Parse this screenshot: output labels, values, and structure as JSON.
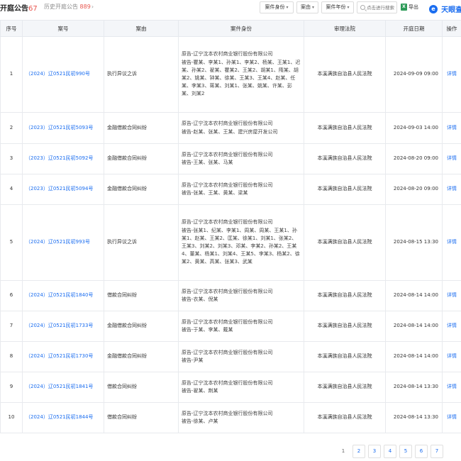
{
  "header": {
    "title": "开庭公告",
    "title_count": "67",
    "history_label": "历史开庭公告",
    "history_count": "889",
    "history_chevron": "›"
  },
  "filters": [
    {
      "label": "案件身份",
      "caret": "▾"
    },
    {
      "label": "案由",
      "caret": "▾"
    },
    {
      "label": "案件年份",
      "caret": "▾"
    }
  ],
  "search": {
    "placeholder": "点击进行搜索"
  },
  "export_label": "导出",
  "brand": {
    "name": "天眼查",
    "logo_glyph": "e"
  },
  "table": {
    "columns": [
      "序号",
      "案号",
      "案由",
      "案件身份",
      "审理法院",
      "开庭日期",
      "操作"
    ],
    "rows": [
      {
        "idx": "1",
        "case_no": "（2024）辽0521民初990号",
        "cause": "执行异议之诉",
        "parties": [
          "原告-辽宁沈本农村商业银行股份有限公司",
          "被告-瞿某、李某1、孙某1、李某2、杨某、王某1、迟某、孙某2、翟某、瞿某2、王某2、胡某1、隋某、胡某2、姚某、钟某、徐某、王某3、王某4、赵某、任某、李某3、蒋某、刘某1、张某、姚某、许某、彭某、刘某2"
        ],
        "court": "本溪满族自治县人民法院",
        "date": "2024-09-09 09:00",
        "op": "详情"
      },
      {
        "idx": "2",
        "case_no": "（2023）辽0521民初5093号",
        "cause": "金融借款合同纠纷",
        "parties": [
          "原告-辽宁沈本农村商业银行股份有限公司",
          "被告-赵某、张某、王某、建兴房屋开发公司"
        ],
        "court": "本溪满族自治县人民法院",
        "date": "2024-09-03 14:00",
        "op": "详情"
      },
      {
        "idx": "3",
        "case_no": "（2023）辽0521民初5092号",
        "cause": "金融借款合同纠纷",
        "parties": [
          "原告-辽宁沈本农村商业银行股份有限公司",
          "被告-王某、张某、马某"
        ],
        "court": "本溪满族自治县人民法院",
        "date": "2024-08-20 09:00",
        "op": "详情"
      },
      {
        "idx": "4",
        "case_no": "（2023）辽0521民初5094号",
        "cause": "金融借款合同纠纷",
        "parties": [
          "原告-辽宁沈本农村商业银行股份有限公司",
          "被告-张某、王某、黄某、梁某"
        ],
        "court": "本溪满族自治县人民法院",
        "date": "2024-08-20 09:00",
        "op": "详情"
      },
      {
        "idx": "5",
        "case_no": "（2024）辽0521民初993号",
        "cause": "执行异议之诉",
        "parties": [
          "原告-辽宁沈本农村商业银行股份有限公司",
          "被告-张某1、纪某、李某1、周某、周某、王某1、孙某1、赵某、王某2、匡某、徐某1、刘某1、张某2、王某3、刘某2、刘某3、邓某、李某2、孙某2、王某4、董某、杨某1、刘某4、王某5、李某3、杨某2、徐某2、黄某、高某、张某3、武某"
        ],
        "court": "本溪满族自治县人民法院",
        "date": "2024-08-15 13:30",
        "op": "详情"
      },
      {
        "idx": "6",
        "case_no": "（2024）辽0521民初1840号",
        "cause": "借款合同纠纷",
        "parties": [
          "原告-辽宁沈本农村商业银行股份有限公司",
          "被告-衣某、倪某"
        ],
        "court": "本溪满族自治县人民法院",
        "date": "2024-08-14 14:00",
        "op": "详情"
      },
      {
        "idx": "7",
        "case_no": "（2024）辽0521民初1733号",
        "cause": "金融借款合同纠纷",
        "parties": [
          "原告-辽宁沈本农村商业银行股份有限公司",
          "被告-于某、李某、戴某"
        ],
        "court": "本溪满族自治县人民法院",
        "date": "2024-08-14 14:00",
        "op": "详情"
      },
      {
        "idx": "8",
        "case_no": "（2024）辽0521民初1730号",
        "cause": "金融借款合同纠纷",
        "parties": [
          "原告-辽宁沈本农村商业银行股份有限公司",
          "被告-尹某"
        ],
        "court": "本溪满族自治县人民法院",
        "date": "2024-08-14 14:00",
        "op": "详情"
      },
      {
        "idx": "9",
        "case_no": "（2024）辽0521民初1841号",
        "cause": "借款合同纠纷",
        "parties": [
          "原告-辽宁沈本农村商业银行股份有限公司",
          "被告-翟某、荆某"
        ],
        "court": "本溪满族自治县人民法院",
        "date": "2024-08-14 13:30",
        "op": "详情"
      },
      {
        "idx": "10",
        "case_no": "（2024）辽0521民初1844号",
        "cause": "借款合同纠纷",
        "parties": [
          "原告-辽宁沈本农村商业银行股份有限公司",
          "被告-徐某、卢某"
        ],
        "court": "本溪满族自治县人民法院",
        "date": "2024-08-14 13:30",
        "op": "详情"
      }
    ]
  },
  "pagination": {
    "current": "1",
    "pages": [
      "1",
      "2",
      "3",
      "4",
      "5",
      "6",
      "7"
    ]
  }
}
